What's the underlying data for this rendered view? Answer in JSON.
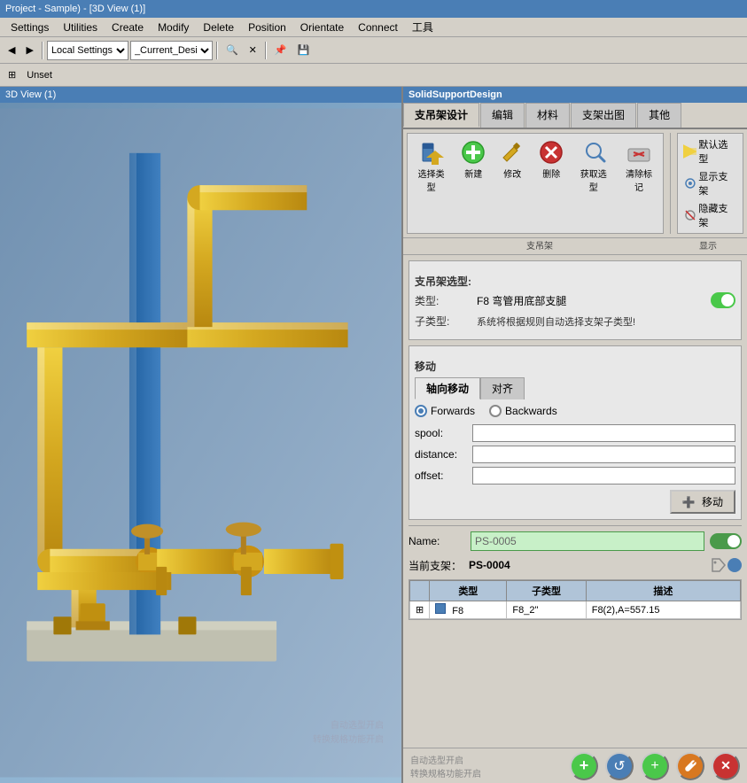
{
  "titleBar": {
    "text": "Project - Sample) - [3D View (1)]"
  },
  "menuBar": {
    "items": [
      "Settings",
      "Utilities",
      "Create",
      "Modify",
      "Delete",
      "Position",
      "Orientate",
      "Connect",
      "工具"
    ]
  },
  "toolbar": {
    "backLabel": "◀",
    "forwardLabel": "▶",
    "localSettings": "Local Settings",
    "currentDesign": "_Current_Desi",
    "searchIcon": "🔍",
    "closeIcon": "✕",
    "pinIcon": "📌",
    "saveIcon": "💾"
  },
  "secondToolbar": {
    "unset": "Unset"
  },
  "rightPanel": {
    "title": "SolidSupportDesign",
    "tabs": [
      {
        "label": "支吊架设计",
        "active": true
      },
      {
        "label": "编辑"
      },
      {
        "label": "材料"
      },
      {
        "label": "支架出图"
      },
      {
        "label": "其他"
      }
    ],
    "ribbonButtons": [
      {
        "icon": "🖱️",
        "label": "选择类型"
      },
      {
        "icon": "➕",
        "label": "新建"
      },
      {
        "icon": "🔧",
        "label": "修改"
      },
      {
        "icon": "✖️",
        "label": "删除"
      },
      {
        "icon": "🎯",
        "label": "获取选型"
      },
      {
        "icon": "🚫",
        "label": "清除标记"
      }
    ],
    "ribbonRight": [
      {
        "icon": "⚡",
        "label": "默认选型"
      },
      {
        "icon": "👁️",
        "label": "显示支架"
      },
      {
        "icon": "🙈",
        "label": "隐藏支架"
      }
    ],
    "groups": [
      "支吊架",
      "显示"
    ],
    "supportSelection": {
      "title": "支吊架选型:",
      "typeLabel": "类型:",
      "typeValue": "F8  弯管用底部支腿",
      "subtypeLabel": "子类型:",
      "subtypeValue": "系统将根据规则自动选择支架子类型!"
    },
    "movement": {
      "title": "移动",
      "tabs": [
        "轴向移动",
        "对齐"
      ],
      "activeTab": "轴向移动",
      "radioForwards": "Forwards",
      "radioBackwards": "Backwards",
      "activeRadio": "Forwards",
      "fields": [
        {
          "label": "spool:",
          "value": ""
        },
        {
          "label": "distance:",
          "value": ""
        },
        {
          "label": "offset:",
          "value": ""
        }
      ],
      "moveButton": "移动"
    },
    "nameRow": {
      "label": "Name:",
      "value": "PS-0005",
      "placeholder": "PS-0005"
    },
    "currentSupport": {
      "label": "当前支架：",
      "value": "PS-0004"
    },
    "table": {
      "headers": [
        "类型",
        "子类型",
        "描述"
      ],
      "rows": [
        {
          "expand": "⊞",
          "typeIcon": "■",
          "type": "F8",
          "subtype": "F8_2\"",
          "description": "F8(2),A=557.15"
        }
      ]
    }
  },
  "bottomToolbar": {
    "buttons": [
      {
        "icon": "+",
        "color": "green",
        "label": "add"
      },
      {
        "icon": "↺",
        "color": "blue",
        "label": "refresh"
      },
      {
        "icon": "+",
        "color": "green2",
        "label": "add2"
      },
      {
        "icon": "🔧",
        "color": "orange",
        "label": "settings"
      },
      {
        "icon": "✕",
        "color": "red",
        "label": "close"
      }
    ]
  },
  "watermark": {
    "line1": "自动选型开启",
    "line2": "转换规格功能开启"
  }
}
